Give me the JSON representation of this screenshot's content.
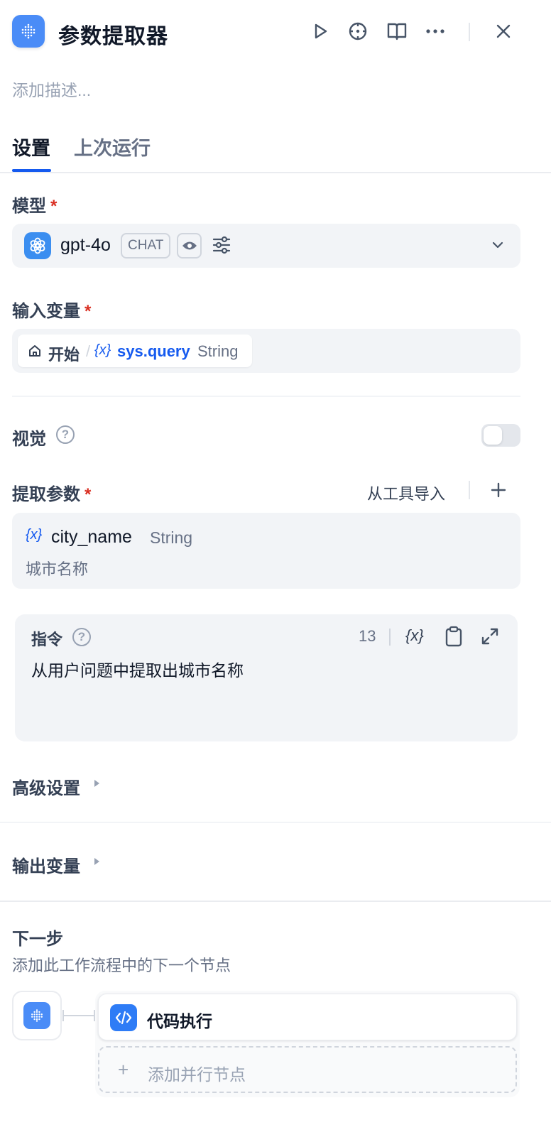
{
  "header": {
    "title": "参数提取器",
    "description_placeholder": "添加描述...",
    "actions": [
      "play-icon",
      "locate-icon",
      "book-icon",
      "more-icon",
      "close-icon"
    ]
  },
  "tabs": [
    {
      "label": "设置",
      "active": true
    },
    {
      "label": "上次运行",
      "active": false
    }
  ],
  "model": {
    "label": "模型",
    "required_mark": "*",
    "name": "gpt-4o",
    "mode_badge": "CHAT"
  },
  "input_variable": {
    "label": "输入变量",
    "required_mark": "*",
    "source_node": "开始",
    "separator": "/",
    "var_symbol": "{x}",
    "variable": "sys.query",
    "type": "String"
  },
  "vision": {
    "label": "视觉",
    "help": "?",
    "enabled": false
  },
  "extract_params": {
    "label": "提取参数",
    "required_mark": "*",
    "import_label": "从工具导入",
    "params": [
      {
        "symbol": "{x}",
        "name": "city_name",
        "type": "String",
        "description": "城市名称"
      }
    ]
  },
  "instruction": {
    "label": "指令",
    "help": "?",
    "char_count": "13",
    "var_symbol": "{x}",
    "text": "从用户问题中提取出城市名称"
  },
  "advanced_settings": {
    "label": "高级设置"
  },
  "output_variables": {
    "label": "输出变量"
  },
  "next_step": {
    "title": "下一步",
    "description": "添加此工作流程中的下一个节点",
    "next_node_label": "代码执行",
    "add_parallel_plus": "+",
    "add_parallel_label": "添加并行节点"
  },
  "colors": {
    "accent": "#155aef",
    "node_blue": "#4a8cf7",
    "required": "#d92d20"
  }
}
